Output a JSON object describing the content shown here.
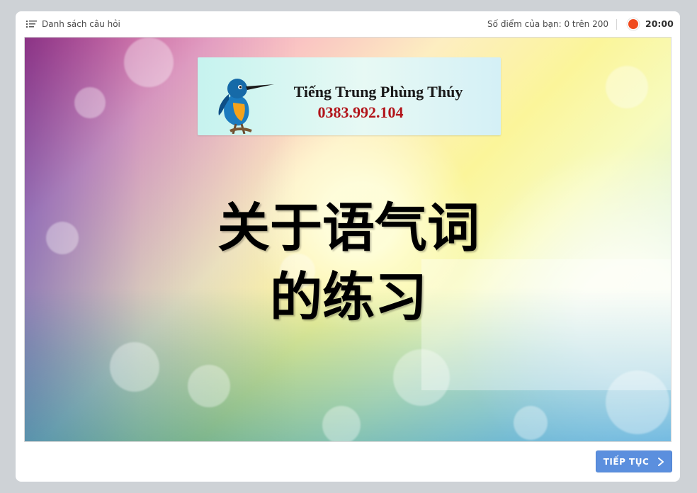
{
  "topbar": {
    "question_list_label": "Danh sách câu hỏi",
    "score_text": "Số điểm của bạn: 0 trên 200",
    "timer": "20:00"
  },
  "slide": {
    "banner_title": "Tiếng Trung Phùng Thúy",
    "banner_phone": "0383.992.104",
    "headline_line1": "关于语气词",
    "headline_line2": "的练习"
  },
  "footer": {
    "next_label": "TIẾP TỤC"
  },
  "colors": {
    "next_button": "#5b8fde",
    "timer_dot": "#f04a1e",
    "phone_text": "#b2141a"
  },
  "icons": {
    "menu": "list-icon",
    "timer": "timer-dot-icon",
    "next": "chevron-right-icon",
    "banner_bird": "kingfisher-bird-icon"
  }
}
